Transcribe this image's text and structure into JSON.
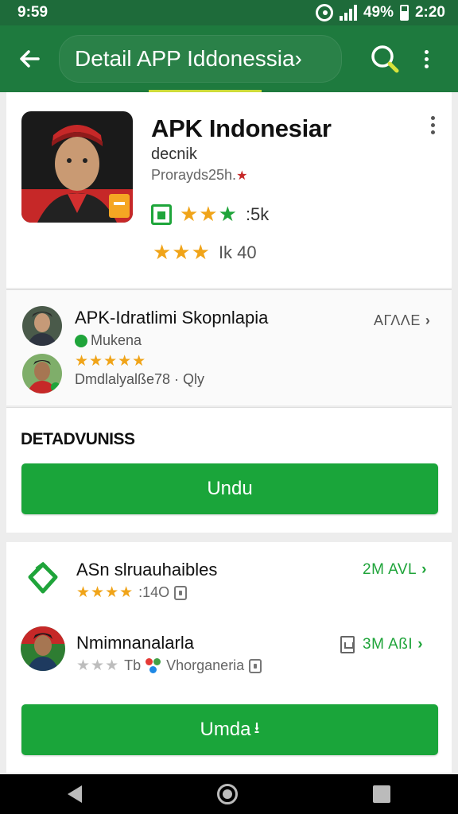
{
  "status_bar": {
    "time_left": "9:59",
    "battery_percent": "49%",
    "time_right": "2:20"
  },
  "app_bar": {
    "title": "Detail APP Iddonessia›"
  },
  "app": {
    "name": "APK Indonesiar",
    "developer": "decnik",
    "subtitle": "Prorayds25h.",
    "rating_primary": ":5k",
    "rating_secondary": "Ik 40",
    "stars_primary": 3,
    "stars_secondary": 3
  },
  "review": {
    "title": "APK-Idratlimi Skopnlapia",
    "author": "Mukena",
    "rating_stars": 5,
    "meta": "Dmdlalyalße78 · Qly",
    "action": "AΓΛΛE"
  },
  "details": {
    "label": "DETADVUNISS",
    "button": "Undu"
  },
  "related": [
    {
      "title": "ASn slruauhaibles",
      "stars": 4,
      "meta": ":14O",
      "action": "2M AVL"
    },
    {
      "title": "Nmimnanalarla",
      "stars": 3,
      "meta": "Tb",
      "meta2": "Vhorganeria",
      "action": "3M AßI"
    }
  ],
  "install_button": "Umda",
  "colors": {
    "primary": "#1e7a3e",
    "button": "#1aa53a",
    "star": "#f0a419"
  }
}
